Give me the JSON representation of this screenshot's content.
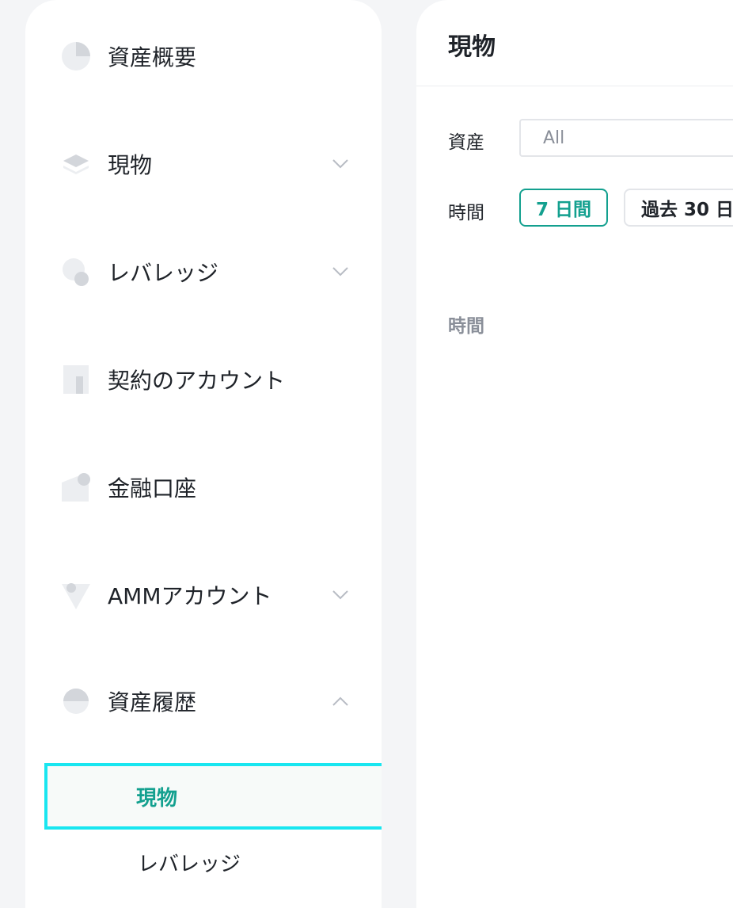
{
  "sidebar": {
    "items": [
      {
        "label": "資産概要",
        "icon": "pie-chart-icon"
      },
      {
        "label": "現物",
        "icon": "layers-icon",
        "chevron": "chevron-down-icon"
      },
      {
        "label": "レバレッジ",
        "icon": "leverage-circles-icon",
        "chevron": "chevron-down-icon"
      },
      {
        "label": "契約のアカウント",
        "icon": "contract-bars-icon"
      },
      {
        "label": "金融口座",
        "icon": "finance-wallet-icon"
      },
      {
        "label": "AMMアカウント",
        "icon": "amm-triangle-icon",
        "chevron": "chevron-down-icon"
      },
      {
        "label": "資産履歴",
        "icon": "history-half-circle-icon",
        "chevron": "chevron-up-icon"
      }
    ],
    "sub_items": [
      {
        "label": "現物",
        "active": true
      },
      {
        "label": "レバレッジ",
        "active": false
      }
    ]
  },
  "main": {
    "title": "現物",
    "asset_label": "資産",
    "asset_value": "All",
    "time_label": "時間",
    "ranges": [
      "7 日間",
      "過去 30 日"
    ],
    "table_header_time": "時間"
  },
  "colors": {
    "accent": "#13a08f",
    "highlight_border": "#19e6f0",
    "icon_gray": "#d9dbe0"
  }
}
